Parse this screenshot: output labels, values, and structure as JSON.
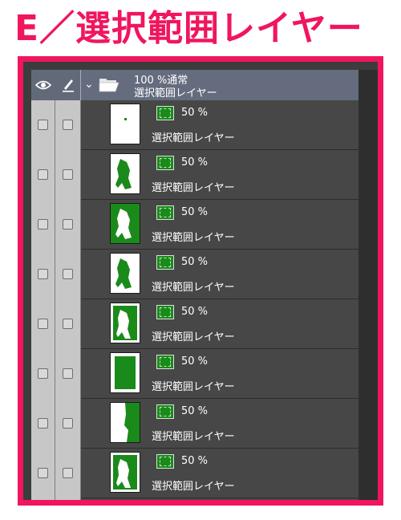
{
  "title": "E／選択範囲レイヤー",
  "colors": {
    "accent": "#f0165e",
    "mask_green": "#1a8a1a",
    "panel_bg": "#474747",
    "header_bg": "#646c7e"
  },
  "header": {
    "eye_icon": "eye-icon",
    "pen_icon": "pen-icon",
    "chevron_icon": "chevron-down-icon",
    "folder_icon": "folder-open-icon",
    "blend_info": "100 %通常",
    "folder_name": "選択範囲レイヤー"
  },
  "layers": [
    {
      "opacity": "50 %",
      "name": "選択範囲レイヤー",
      "thumb": "dot"
    },
    {
      "opacity": "50 %",
      "name": "選択範囲レイヤー",
      "thumb": "figure"
    },
    {
      "opacity": "50 %",
      "name": "選択範囲レイヤー",
      "thumb": "inverted"
    },
    {
      "opacity": "50 %",
      "name": "選択範囲レイヤー",
      "thumb": "figure"
    },
    {
      "opacity": "50 %",
      "name": "選択範囲レイヤー",
      "thumb": "framed"
    },
    {
      "opacity": "50 %",
      "name": "選択範囲レイヤー",
      "thumb": "solid"
    },
    {
      "opacity": "50 %",
      "name": "選択範囲レイヤー",
      "thumb": "split"
    },
    {
      "opacity": "50 %",
      "name": "選択範囲レイヤー",
      "thumb": "framed"
    }
  ]
}
